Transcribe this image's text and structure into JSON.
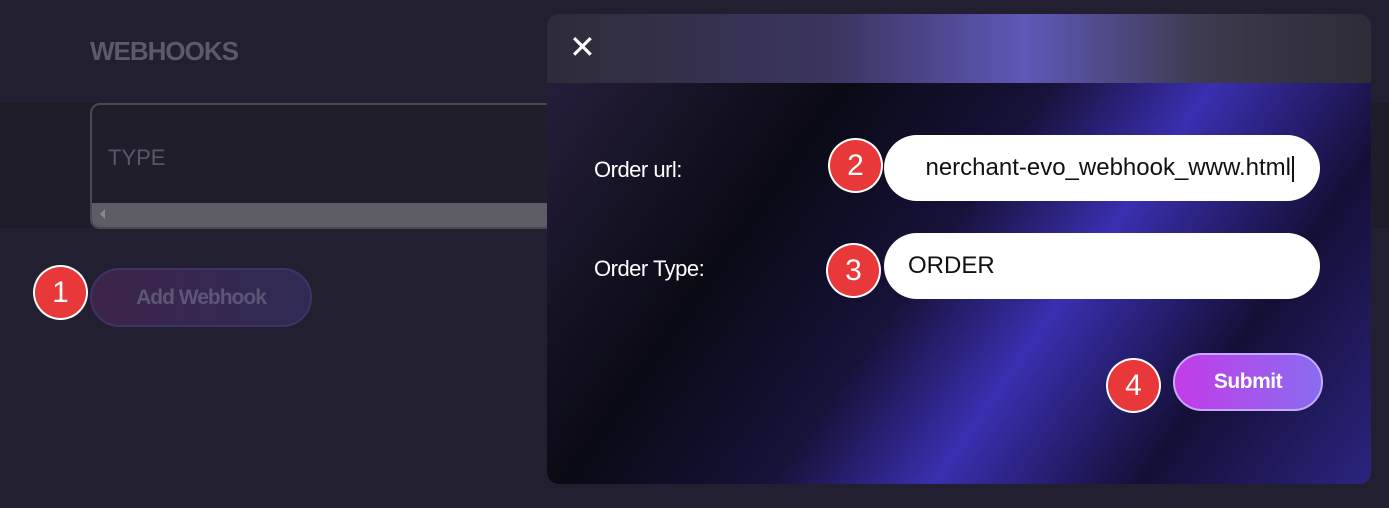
{
  "page": {
    "title": "WEBHOOKS",
    "table": {
      "columns": [
        "TYPE"
      ]
    },
    "add_button_label": "Add Webhook"
  },
  "modal": {
    "close_icon": "close-icon",
    "fields": {
      "order_url": {
        "label": "Order url:",
        "value": "nerchant-evo_webhook_www.html"
      },
      "order_type": {
        "label": "Order Type:",
        "value": "ORDER"
      }
    },
    "submit_label": "Submit"
  },
  "badges": [
    "1",
    "2",
    "3",
    "4"
  ],
  "colors": {
    "badge": "#e8383a",
    "submit_gradient_start": "#c23be8",
    "submit_gradient_end": "#8a6cf0"
  }
}
